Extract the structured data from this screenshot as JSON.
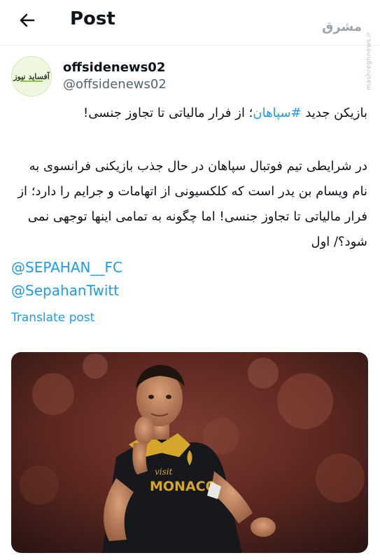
{
  "header": {
    "title": "Post"
  },
  "watermark": {
    "logo": "مشرق",
    "url": "mashreghnews.ir"
  },
  "tweet": {
    "avatar_text": "آفساید نیوز",
    "display_name": "offsidenews02",
    "handle": "@offsidenews02",
    "headline_pre": "بازیکن جدید ",
    "hashtag": "#سپاهان",
    "headline_post": "؛ از فرار مالیاتی تا تجاوز جنسی!",
    "body": "در شرایطی تیم فوتبال سپاهان در حال جذب بازیکنی فرانسوی به نام ویسام بن یدر است که کلکسیونی از اتهامات و جرایم را دارد؛ از فرار مالیاتی تا تجاوز جنسی! اما چگونه به تمامی اینها توجهی نمی شود؟/ اول",
    "mentions": [
      "@SEPAHAN__FC",
      "@SepahanTwitt"
    ],
    "translate_label": "Translate post",
    "jersey_text_small": "visit",
    "jersey_text": "MONACO"
  },
  "colors": {
    "link": "#1d9bf0",
    "text": "#0f1419",
    "muted": "#536471"
  }
}
